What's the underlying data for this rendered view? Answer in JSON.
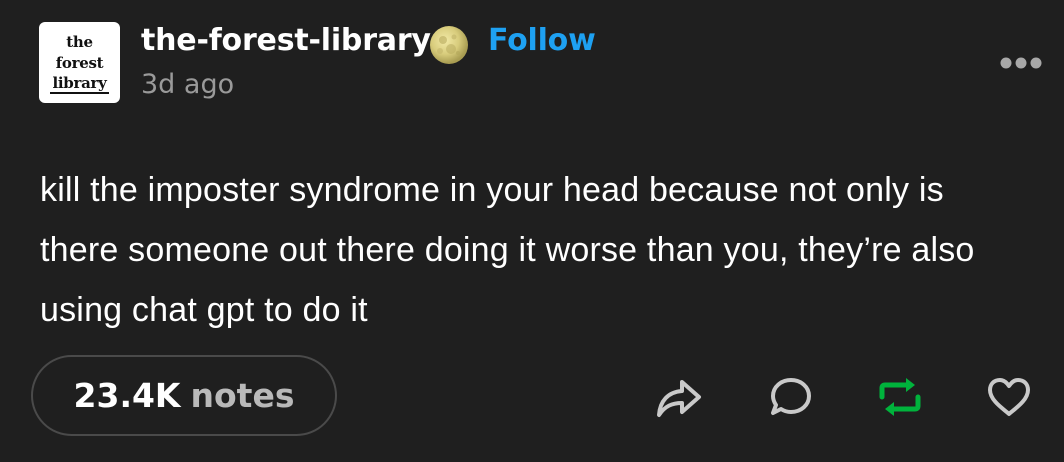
{
  "post": {
    "avatar": {
      "line1": "the",
      "line2": "forest",
      "line3": "library"
    },
    "blog_name": "the-forest-library",
    "follow_label": "Follow",
    "timestamp": "3d ago",
    "body": "kill the imposter syndrome in your head because not only is there someone out there doing it worse than you, they’re also using chat gpt to do it",
    "notes_count": "23.4K",
    "notes_label": "notes"
  },
  "icons": {
    "badge": "full-moon-icon",
    "menu": "more-options-icon",
    "share": "share-icon",
    "reply": "reply-icon",
    "reblog": "reblog-icon",
    "like": "heart-icon"
  },
  "colors": {
    "background": "#1f1f1f",
    "follow": "#1ea1f2",
    "reblog": "#00b33c",
    "secondary_text": "#9a9a9a",
    "icon": "#c9c9c9"
  }
}
